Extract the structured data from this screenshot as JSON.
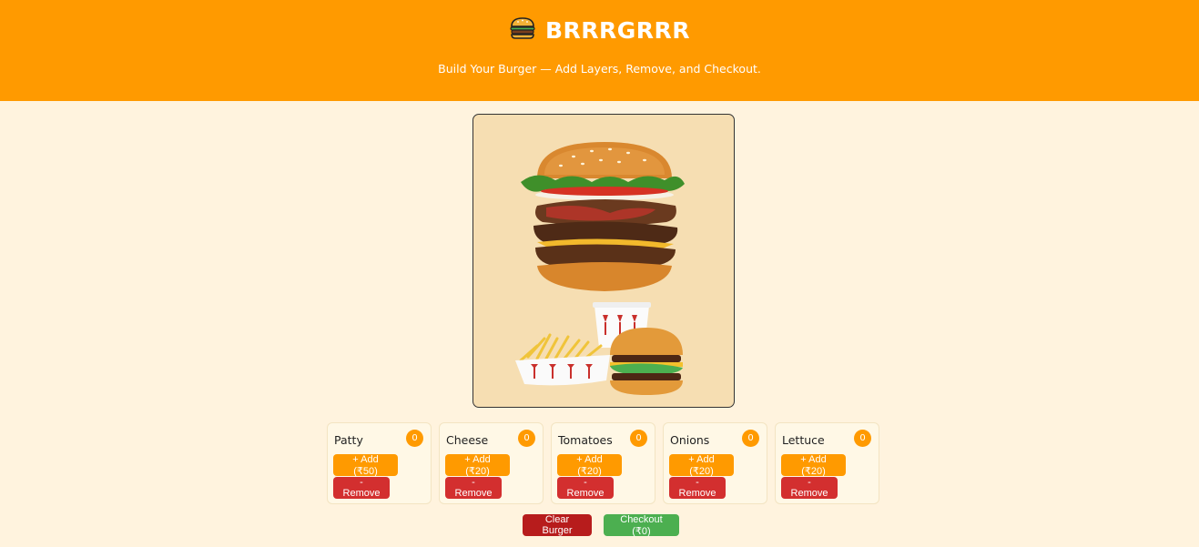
{
  "header": {
    "logo_icon": "burger-icon",
    "title": "BRRRGRRR",
    "tagline": "Build Your Burger — Add Layers, Remove, and Checkout."
  },
  "preview": {
    "top_image": "stacked-burger-image",
    "bottom_image": "burger-fries-drink-combo-image"
  },
  "ingredients": [
    {
      "name": "Patty",
      "count": "0",
      "add_label": "+ Add (₹50)",
      "remove_label": "- Remove"
    },
    {
      "name": "Cheese",
      "count": "0",
      "add_label": "+ Add (₹20)",
      "remove_label": "- Remove"
    },
    {
      "name": "Tomatoes",
      "count": "0",
      "add_label": "+ Add (₹20)",
      "remove_label": "- Remove"
    },
    {
      "name": "Onions",
      "count": "0",
      "add_label": "+ Add (₹20)",
      "remove_label": "- Remove"
    },
    {
      "name": "Lettuce",
      "count": "0",
      "add_label": "+ Add (₹20)",
      "remove_label": "- Remove"
    }
  ],
  "actions": {
    "clear_label": "Clear Burger",
    "checkout_label": "Checkout (₹0)"
  },
  "colors": {
    "header": "#ff9a00",
    "background": "#fff3de",
    "add": "#ff9a00",
    "remove": "#d32f2f",
    "clear": "#b71c1c",
    "checkout": "#4caf50"
  }
}
